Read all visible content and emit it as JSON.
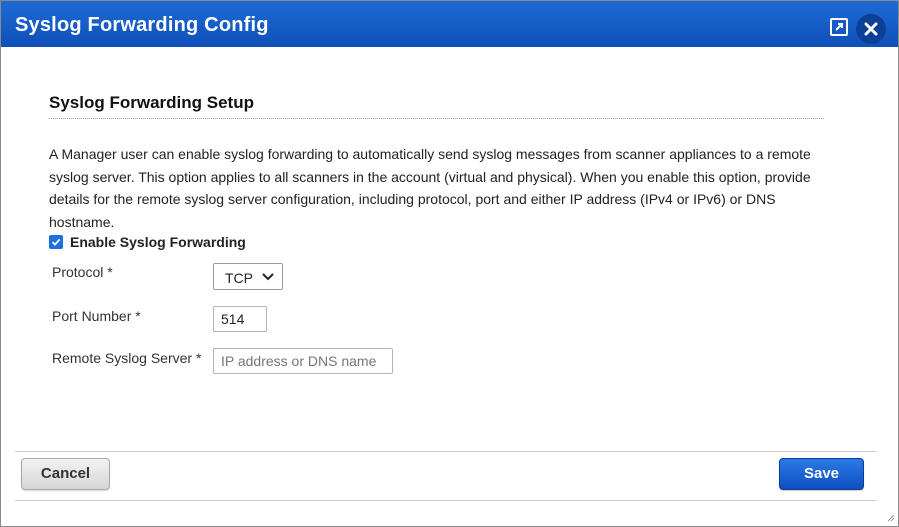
{
  "dialog": {
    "title": "Syslog Forwarding Config",
    "icons": {
      "popout": "popout-icon",
      "close": "close-icon"
    },
    "colors": {
      "titlebar": "#1560cc",
      "save_button": "#1a63d6",
      "checkbox": "#1f6fe0"
    }
  },
  "setup": {
    "heading": "Syslog Forwarding Setup",
    "description": "A Manager user can enable syslog forwarding to automatically send syslog messages from scanner appliances to a remote syslog server. This option applies to all scanners in the account (virtual and physical). When you enable this option, provide details for the remote syslog server configuration, including protocol, port and either IP address (IPv4 or IPv6) or DNS hostname."
  },
  "form": {
    "enable": {
      "label": "Enable Syslog Forwarding",
      "checked": true
    },
    "protocol": {
      "label": "Protocol *",
      "selected": "TCP"
    },
    "port": {
      "label": "Port Number *",
      "value": "514"
    },
    "server": {
      "label": "Remote Syslog Server *",
      "value": "",
      "placeholder": "IP address or DNS name"
    }
  },
  "footer": {
    "cancel_label": "Cancel",
    "save_label": "Save"
  }
}
